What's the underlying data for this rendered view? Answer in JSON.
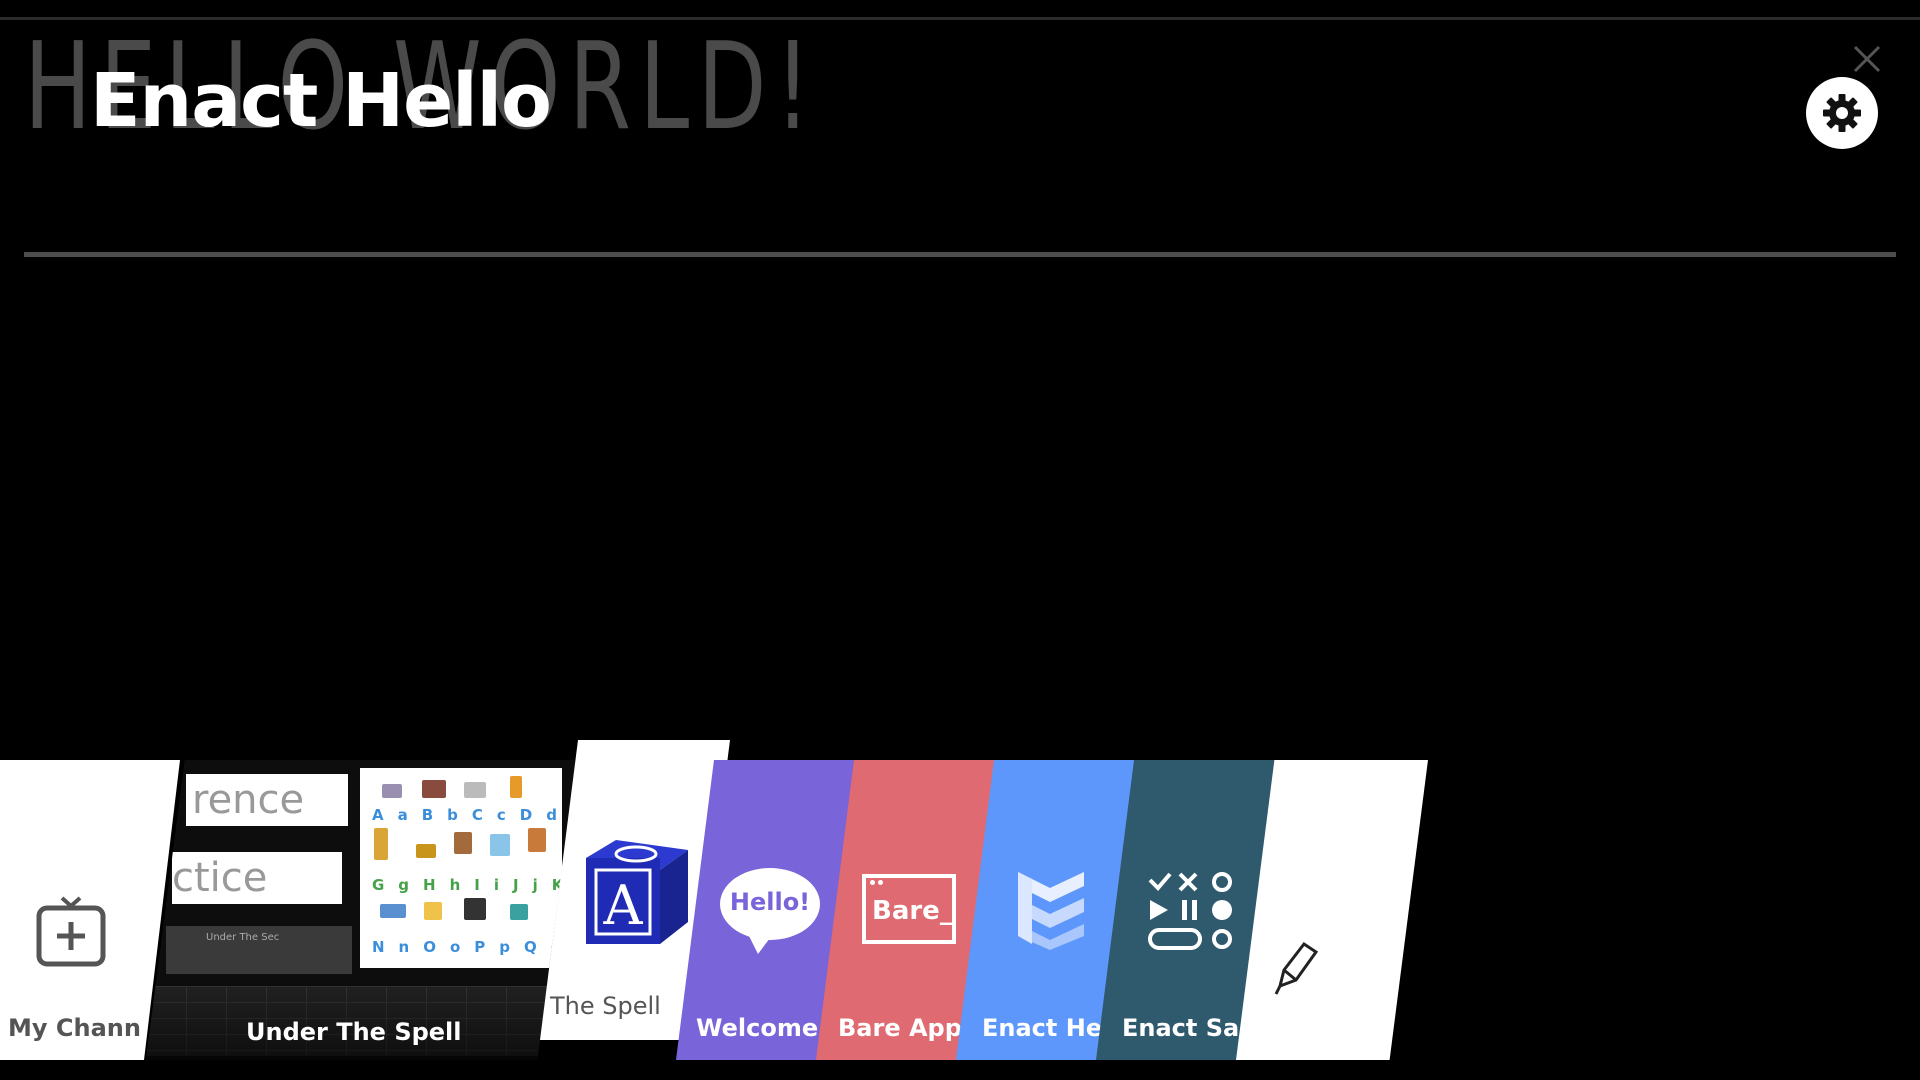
{
  "header": {
    "background_title": "HELLO WORLD!",
    "app_title": "Enact Hello",
    "close_icon": "close-icon",
    "settings_icon": "gear-icon"
  },
  "launcher": {
    "cards": [
      {
        "label": "My Channels",
        "display": "My Chann",
        "icon": "add-channel-icon",
        "color": "#ffffff"
      },
      {
        "label": "Under The Spell",
        "display": "Under The Spell",
        "icon": "app-preview",
        "color": "#0d0d0d",
        "preview": {
          "field1": "rence",
          "field2": "ctice",
          "caption": "Under The Sec"
        }
      },
      {
        "label": "The Spell",
        "display": "The Spell",
        "icon": "letter-block-icon",
        "color": "#ffffff",
        "block_letter": "A"
      },
      {
        "label": "Welcome",
        "display": "Welcome",
        "icon": "speech-bubble-icon",
        "color": "#7a64d9",
        "icon_text": "Hello!"
      },
      {
        "label": "Bare App",
        "display": "Bare App",
        "icon": "browser-window-icon",
        "color": "#df6a72",
        "icon_text": "Bare_"
      },
      {
        "label": "Enact Hello",
        "display": "Enact Hel",
        "icon": "enact-logo-icon",
        "color": "#5e97fb"
      },
      {
        "label": "Enact Sampler",
        "display": "Enact San",
        "icon": "controls-grid-icon",
        "color": "#2f5a6e"
      },
      {
        "label": "",
        "display": "",
        "icon": "pencil-edit-icon",
        "color": "#ffffff"
      }
    ]
  }
}
